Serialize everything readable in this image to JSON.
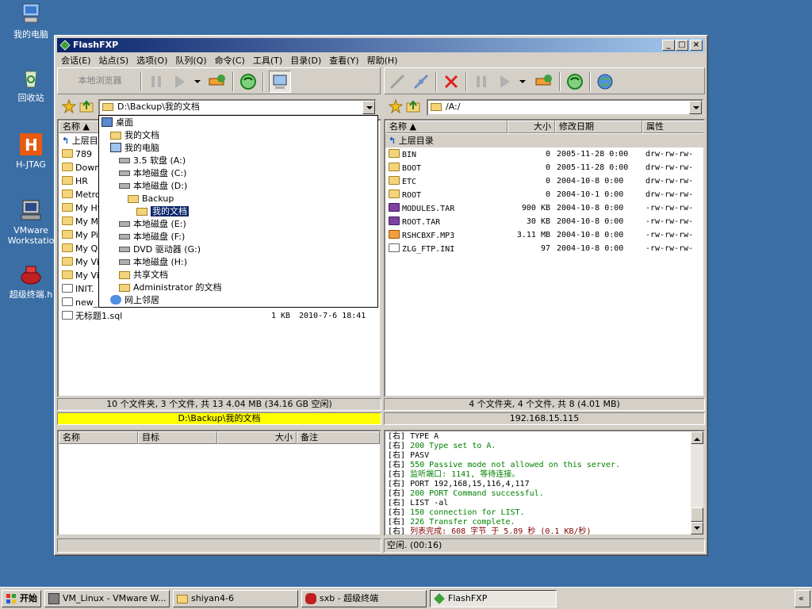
{
  "desktop": {
    "icons": [
      {
        "label": "我的电脑"
      },
      {
        "label": "回收站"
      },
      {
        "label": "H-JTAG"
      },
      {
        "label": "VMware Workstatio"
      },
      {
        "label": "超级终端.h"
      }
    ]
  },
  "window": {
    "title": "FlashFXP",
    "menu": [
      "会话(E)",
      "站点(S)",
      "选项(O)",
      "队列(Q)",
      "命令(C)",
      "工具(T)",
      "目录(D)",
      "查看(Y)",
      "帮助(H)"
    ],
    "left_toolbar_label": "本地浏览器"
  },
  "left": {
    "path": "D:\\Backup\\我的文档",
    "col_name": "名称",
    "visible_rows": [
      {
        "name": "上层目",
        "type": "up"
      },
      {
        "name": "789",
        "type": "folder"
      },
      {
        "name": "Downl",
        "type": "folder"
      },
      {
        "name": "HR",
        "type": "folder"
      },
      {
        "name": "Metro",
        "type": "folder"
      },
      {
        "name": "My Ht",
        "type": "folder"
      },
      {
        "name": "My Mu",
        "type": "music"
      },
      {
        "name": "My Pi",
        "type": "pic"
      },
      {
        "name": "My QQ",
        "type": "folder"
      },
      {
        "name": "My Vi",
        "type": "video"
      },
      {
        "name": "My Vi",
        "type": "folder"
      },
      {
        "name": "INIT.",
        "type": "file"
      },
      {
        "name": "new_1",
        "type": "file"
      },
      {
        "name": "无标题1.sql",
        "size": "1 KB",
        "date": "2010-7-6 18:41",
        "type": "file"
      }
    ],
    "status": "10 个文件夹, 3 个文件, 共 13 4.04 MB (34.16 GB 空闲)",
    "path_status": "D:\\Backup\\我的文档"
  },
  "dropdown": {
    "items": [
      {
        "label": "桌面",
        "indent": 0
      },
      {
        "label": "我的文档",
        "indent": 1
      },
      {
        "label": "我的电脑",
        "indent": 1
      },
      {
        "label": "3.5 软盘 (A:)",
        "indent": 2
      },
      {
        "label": "本地磁盘 (C:)",
        "indent": 2
      },
      {
        "label": "本地磁盘 (D:)",
        "indent": 2
      },
      {
        "label": "Backup",
        "indent": 3
      },
      {
        "label": "我的文档",
        "indent": 4,
        "selected": true
      },
      {
        "label": "本地磁盘 (E:)",
        "indent": 2
      },
      {
        "label": "本地磁盘 (F:)",
        "indent": 2
      },
      {
        "label": "DVD 驱动器 (G:)",
        "indent": 2
      },
      {
        "label": "本地磁盘 (H:)",
        "indent": 2
      },
      {
        "label": "共享文档",
        "indent": 2
      },
      {
        "label": "Administrator 的文档",
        "indent": 2
      },
      {
        "label": "网上邻居",
        "indent": 1
      }
    ]
  },
  "right": {
    "path": "/A:/",
    "columns": {
      "name": "名称",
      "size": "大小",
      "date": "修改日期",
      "attr": "属性"
    },
    "up_label": "上层目录",
    "rows": [
      {
        "name": "BIN",
        "size": "0",
        "date": "2005-11-28 0:00",
        "attr": "drw-rw-rw-",
        "type": "folder"
      },
      {
        "name": "BOOT",
        "size": "0",
        "date": "2005-11-28 0:00",
        "attr": "drw-rw-rw-",
        "type": "folder"
      },
      {
        "name": "ETC",
        "size": "0",
        "date": "2004-10-8 0:00",
        "attr": "drw-rw-rw-",
        "type": "folder"
      },
      {
        "name": "ROOT",
        "size": "0",
        "date": "2004-10-1 0:00",
        "attr": "drw-rw-rw-",
        "type": "folder"
      },
      {
        "name": "MODULES.TAR",
        "size": "900 KB",
        "date": "2004-10-8 0:00",
        "attr": "-rw-rw-rw-",
        "type": "archive"
      },
      {
        "name": "ROOT.TAR",
        "size": "30 KB",
        "date": "2004-10-8 0:00",
        "attr": "-rw-rw-rw-",
        "type": "archive"
      },
      {
        "name": "RSHCBXF.MP3",
        "size": "3.11 MB",
        "date": "2004-10-8 0:00",
        "attr": "-rw-rw-rw-",
        "type": "audio"
      },
      {
        "name": "ZLG_FTP.INI",
        "size": "97",
        "date": "2004-10-8 0:00",
        "attr": "-rw-rw-rw-",
        "type": "ini"
      }
    ],
    "status": "4 个文件夹, 4 个文件, 共 8 (4.01 MB)",
    "host": "192.168.15.115"
  },
  "queue": {
    "columns": [
      "名称",
      "目标",
      "大小",
      "备注"
    ]
  },
  "log": {
    "lines": [
      {
        "tag": "[右]",
        "text": "TYPE A",
        "color": "#000000"
      },
      {
        "tag": "[右]",
        "text": "200 Type set to A.",
        "color": "#008000"
      },
      {
        "tag": "[右]",
        "text": "PASV",
        "color": "#000000"
      },
      {
        "tag": "[右]",
        "text": "550 Passive mode not allowed on this server.",
        "color": "#008000"
      },
      {
        "tag": "[右]",
        "text": "监听端口: 1141, 等待连接。",
        "color": "#008000"
      },
      {
        "tag": "[右]",
        "text": "PORT 192,168,15,116,4,117",
        "color": "#000000"
      },
      {
        "tag": "[右]",
        "text": "200 PORT Command successful.",
        "color": "#008000"
      },
      {
        "tag": "[右]",
        "text": "LIST -al",
        "color": "#000000"
      },
      {
        "tag": "[右]",
        "text": "150 connection for LIST.",
        "color": "#008000"
      },
      {
        "tag": "[右]",
        "text": "226 Transfer complete.",
        "color": "#008000"
      },
      {
        "tag": "[右]",
        "text": "列表完成: 608 字节 于 5.89 秒 (0.1 KB/秒)",
        "color": "#800000"
      }
    ],
    "status": "空闲. (00:16)"
  },
  "taskbar": {
    "start": "开始",
    "tasks": [
      "VM_Linux - VMware W...",
      "shiyan4-6",
      "sxb - 超级终端",
      "FlashFXP"
    ]
  }
}
